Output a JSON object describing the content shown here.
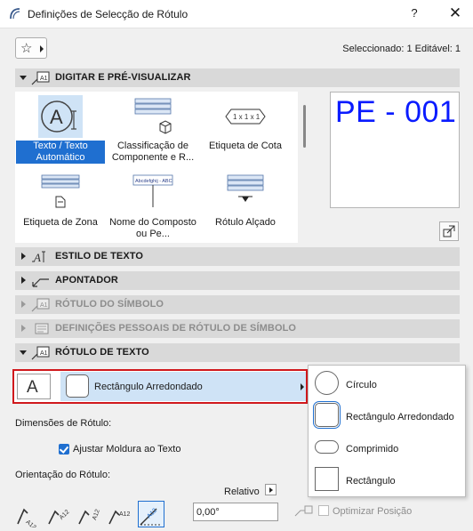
{
  "window": {
    "title": "Definições de Selecção de Rótulo",
    "help_label": "?",
    "close_label": "✕",
    "app_icon": "archicad-arc-icon"
  },
  "toolbar": {
    "favorites_icon": "star-icon",
    "selection_info": "Seleccionado: 1 Editável: 1"
  },
  "sections": {
    "digitar": {
      "label": "DIGITAR E PRÉ-VISUALIZAR",
      "expanded": true
    },
    "estilo": {
      "label": "ESTILO DE TEXTO"
    },
    "apontador": {
      "label": "APONTADOR"
    },
    "rotulo_simbolo": {
      "label": "RÓTULO DO SÍMBOLO",
      "disabled": true
    },
    "definicoes_pessoais": {
      "label": "DEFINIÇÕES PESSOAIS DE RÓTULO DE SÍMBOLO",
      "disabled": true
    },
    "rotulo_texto": {
      "label": "RÓTULO DE TEXTO",
      "expanded": true
    }
  },
  "label_types": [
    {
      "label": "Texto / Texto Automático",
      "selected": true,
      "icon": "auto-text-icon"
    },
    {
      "label": "Classificação de Componente e R...",
      "icon": "component-classification-icon"
    },
    {
      "label": "Etiqueta de Cota",
      "icon": "dimension-tag-icon",
      "sample": "1 x 1 x 1"
    },
    {
      "label": "Etiqueta de Zona",
      "icon": "zone-tag-icon"
    },
    {
      "label": "Nome do Composto ou Pe...",
      "icon": "composite-name-icon",
      "sample": "Abcdefghij - ABC"
    },
    {
      "label": "Rótulo Alçado",
      "icon": "elevation-label-icon"
    }
  ],
  "preview": {
    "text": "PE - 001",
    "color": "#0a1bff"
  },
  "text_label": {
    "text_style_glyph": "A",
    "current_shape": "Rectângulo Arredondado",
    "dimensions_label": "Dimensões de Rótulo:",
    "fit_frame_label": "Ajustar Moldura ao Texto",
    "fit_frame_checked": true,
    "orientation_label": "Orientação do Rótulo:",
    "relative_label": "Relativo",
    "angle_value": "0,00°",
    "optimize_label": "Optimizar Posição",
    "optimize_checked": false,
    "orientation_samples": [
      "A12",
      "A12",
      "A12",
      "A12",
      "A12"
    ]
  },
  "shape_menu": {
    "items": [
      {
        "label": "Círculo",
        "shape": "circle"
      },
      {
        "label": "Rectângulo Arredondado",
        "shape": "rounded-rect",
        "current": true
      },
      {
        "label": "Comprimido",
        "shape": "pill"
      },
      {
        "label": "Rectângulo",
        "shape": "rect"
      }
    ]
  },
  "colors": {
    "accent": "#1f6fd0",
    "highlight_border": "#d0191d",
    "selection_bg": "#cfe3f6",
    "section_bg": "#d9d9d9"
  }
}
